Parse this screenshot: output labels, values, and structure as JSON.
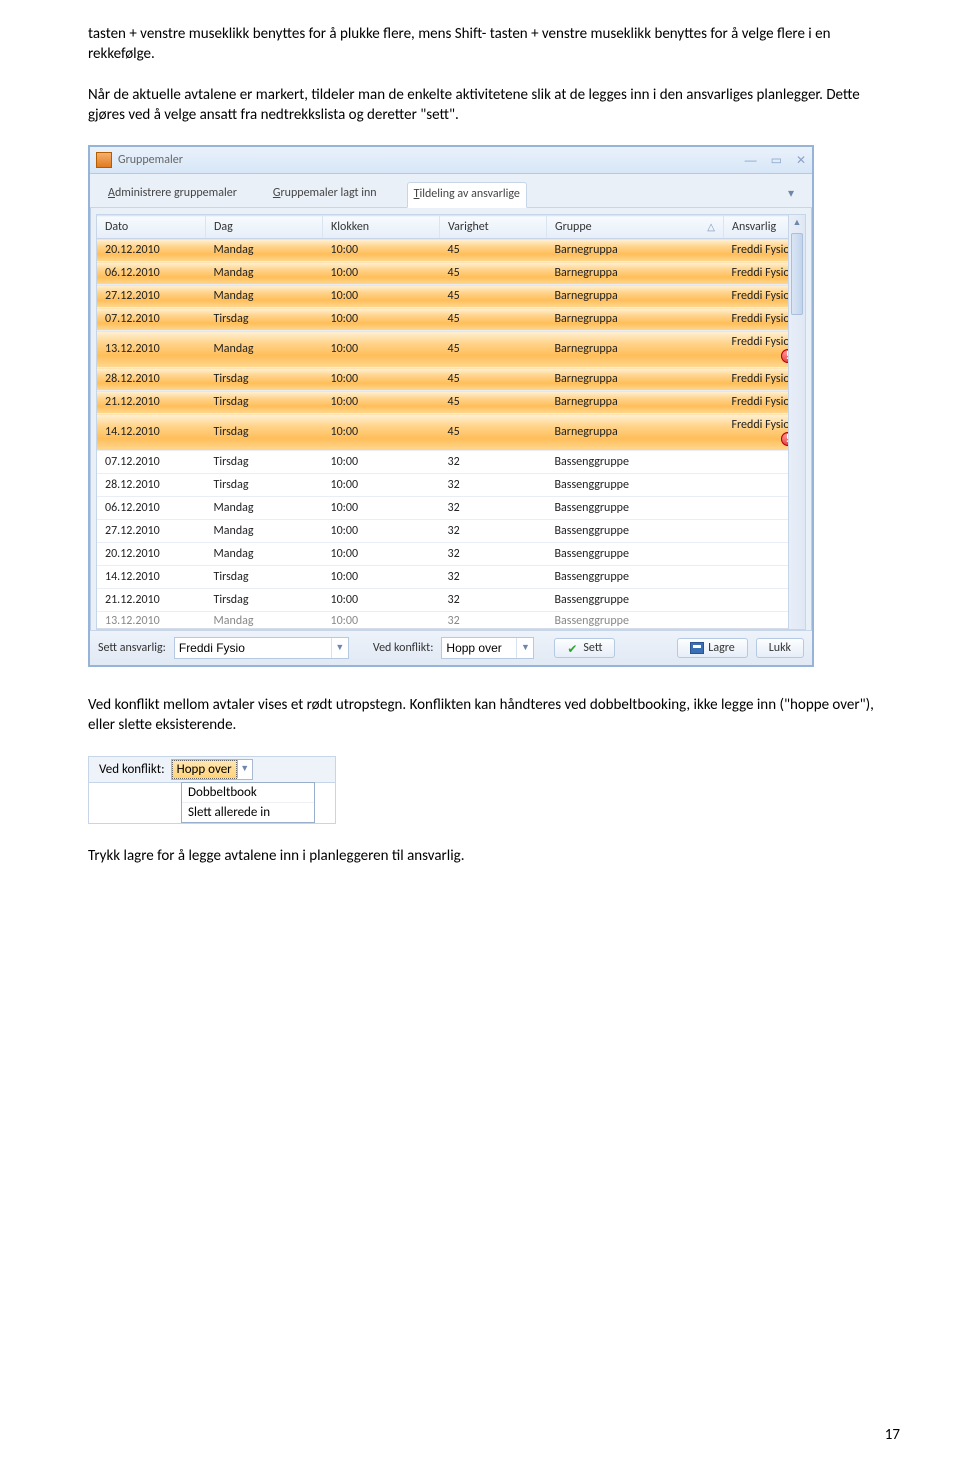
{
  "paragraphs": {
    "p1": "tasten + venstre museklikk benyttes for å plukke flere, mens Shift- tasten + venstre museklikk benyttes for å velge flere i en rekkefølge.",
    "p2": "Når de aktuelle avtalene er markert, tildeler man de enkelte aktivitetene slik at de legges inn i den ansvarliges planlegger. Dette gjøres ved å velge ansatt fra nedtrekkslista og deretter \"sett\".",
    "p3": "Ved konflikt mellom avtaler vises et rødt utropstegn. Konflikten kan håndteres ved dobbeltbooking, ikke legge inn (\"hoppe over\"), eller slette eksisterende.",
    "p4": "Trykk lagre for å legge avtalene inn i planleggeren til ansvarlig."
  },
  "page_number": "17",
  "window": {
    "title": "Gruppemaler",
    "tabs": {
      "t1_pre": "A",
      "t1_rest": "dministrere gruppemaler",
      "t2_pre": "G",
      "t2_rest": "ruppemaler lagt inn",
      "t3_pre": "T",
      "t3_rest": "ildeling av ansvarlige"
    },
    "columns": {
      "c1": "Dato",
      "c2": "Dag",
      "c3": "Klokken",
      "c4": "Varighet",
      "c5": "Gruppe",
      "c5_sort": "△",
      "c6": "Ansvarlig"
    },
    "rows": [
      {
        "sel": true,
        "d": "20.12.2010",
        "dag": "Mandag",
        "kl": "10:00",
        "var": "45",
        "gr": "Barnegruppa",
        "an": "Freddi Fysio",
        "alert": false
      },
      {
        "sel": true,
        "d": "06.12.2010",
        "dag": "Mandag",
        "kl": "10:00",
        "var": "45",
        "gr": "Barnegruppa",
        "an": "Freddi Fysio",
        "alert": false
      },
      {
        "sel": true,
        "d": "27.12.2010",
        "dag": "Mandag",
        "kl": "10:00",
        "var": "45",
        "gr": "Barnegruppa",
        "an": "Freddi Fysio",
        "alert": false
      },
      {
        "sel": true,
        "d": "07.12.2010",
        "dag": "Tirsdag",
        "kl": "10:00",
        "var": "45",
        "gr": "Barnegruppa",
        "an": "Freddi Fysio",
        "alert": false
      },
      {
        "sel": true,
        "d": "13.12.2010",
        "dag": "Mandag",
        "kl": "10:00",
        "var": "45",
        "gr": "Barnegruppa",
        "an": "Freddi Fysio",
        "alert": true
      },
      {
        "sel": true,
        "d": "28.12.2010",
        "dag": "Tirsdag",
        "kl": "10:00",
        "var": "45",
        "gr": "Barnegruppa",
        "an": "Freddi Fysio",
        "alert": false
      },
      {
        "sel": true,
        "d": "21.12.2010",
        "dag": "Tirsdag",
        "kl": "10:00",
        "var": "45",
        "gr": "Barnegruppa",
        "an": "Freddi Fysio",
        "alert": false
      },
      {
        "sel": true,
        "d": "14.12.2010",
        "dag": "Tirsdag",
        "kl": "10:00",
        "var": "45",
        "gr": "Barnegruppa",
        "an": "Freddi Fysio",
        "alert": true
      },
      {
        "sel": false,
        "d": "07.12.2010",
        "dag": "Tirsdag",
        "kl": "10:00",
        "var": "32",
        "gr": "Bassenggruppe",
        "an": "",
        "alert": false
      },
      {
        "sel": false,
        "d": "28.12.2010",
        "dag": "Tirsdag",
        "kl": "10:00",
        "var": "32",
        "gr": "Bassenggruppe",
        "an": "",
        "alert": false
      },
      {
        "sel": false,
        "d": "06.12.2010",
        "dag": "Mandag",
        "kl": "10:00",
        "var": "32",
        "gr": "Bassenggruppe",
        "an": "",
        "alert": false
      },
      {
        "sel": false,
        "d": "27.12.2010",
        "dag": "Mandag",
        "kl": "10:00",
        "var": "32",
        "gr": "Bassenggruppe",
        "an": "",
        "alert": false
      },
      {
        "sel": false,
        "d": "20.12.2010",
        "dag": "Mandag",
        "kl": "10:00",
        "var": "32",
        "gr": "Bassenggruppe",
        "an": "",
        "alert": false
      },
      {
        "sel": false,
        "d": "14.12.2010",
        "dag": "Tirsdag",
        "kl": "10:00",
        "var": "32",
        "gr": "Bassenggruppe",
        "an": "",
        "alert": false
      },
      {
        "sel": false,
        "d": "21.12.2010",
        "dag": "Tirsdag",
        "kl": "10:00",
        "var": "32",
        "gr": "Bassenggruppe",
        "an": "",
        "alert": false
      },
      {
        "sel": false,
        "d": "13.12.2010",
        "dag": "Mandag",
        "kl": "10:00",
        "var": "32",
        "gr": "Bassenggruppe",
        "an": "",
        "alert": false,
        "cut": true
      }
    ],
    "footer": {
      "label_responsible": "Sett ansvarlig:",
      "responsible_value": "Freddi Fysio",
      "label_conflict": "Ved konflikt:",
      "conflict_value": "Hopp over",
      "btn_sett": "Sett",
      "btn_lagre": "Lagre",
      "btn_lukk": "Lukk"
    }
  },
  "small": {
    "label": "Ved konflikt:",
    "selected": "Hopp over",
    "opt1": "Dobbeltbook",
    "opt2": "Slett allerede in"
  }
}
